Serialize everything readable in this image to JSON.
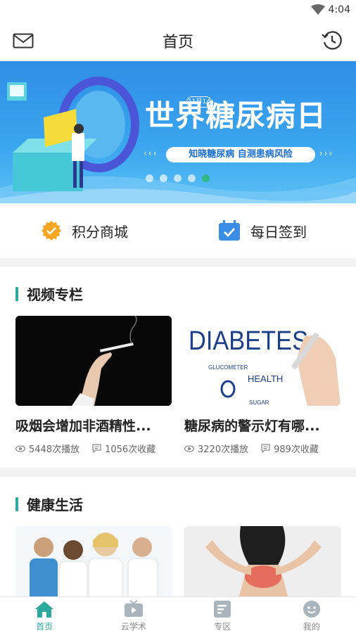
{
  "status": {
    "time": "4:04"
  },
  "header": {
    "title": "首页"
  },
  "banner": {
    "date_tag": "11月14",
    "headline": "世界糖尿病日",
    "slogan": "知晓糖尿病  自测患病风险",
    "arrows_left": "‹‹‹",
    "arrows_right": "›››",
    "dots": 5,
    "active_dot": 4
  },
  "quick": {
    "points_label": "积分商城",
    "checkin_label": "每日签到"
  },
  "video_section": {
    "title": "视频专栏",
    "cards": [
      {
        "title": "吸烟会增加非酒精性...",
        "plays": "5448次播放",
        "favs": "1056次收藏",
        "thumb": "smoking-hand"
      },
      {
        "title": "糖尿病的警示灯有哪...",
        "plays": "3220次播放",
        "favs": "989次收藏",
        "thumb": "diabetes-text"
      }
    ],
    "thumb_text": {
      "word": "DIABETES",
      "glucometer": "GLUCOMETER",
      "health": "HEALTH",
      "sugar": "SUGAR"
    }
  },
  "health_section": {
    "title": "健康生活"
  },
  "tabs": [
    {
      "label": "首页",
      "active": true
    },
    {
      "label": "云学术",
      "active": false
    },
    {
      "label": "专区",
      "active": false
    },
    {
      "label": "我的",
      "active": false
    }
  ],
  "colors": {
    "accent": "#2ba99d",
    "banner_blue": "#2f8ee6",
    "points_orange": "#f5a623",
    "checkin_blue": "#3a8ee6"
  }
}
